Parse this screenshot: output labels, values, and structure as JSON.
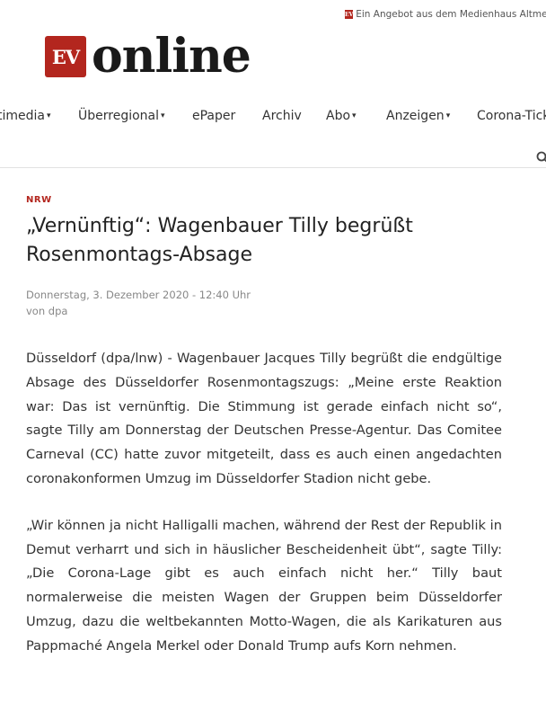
{
  "topbar": {
    "text": "Ein Angebot aus dem Medienhaus Altmep",
    "mini_logo": "EV"
  },
  "logo": {
    "box": "EV",
    "text": "online"
  },
  "nav": {
    "items": [
      {
        "label": "timedia",
        "caret": "▾"
      },
      {
        "label": "Überregional",
        "caret": "▾"
      },
      {
        "label": "ePaper",
        "caret": ""
      },
      {
        "label": "Archiv",
        "caret": ""
      },
      {
        "label": "Abo",
        "caret": "▾"
      },
      {
        "label": "Anzeigen",
        "caret": "▾"
      },
      {
        "label": "Corona-Tick",
        "caret": ""
      }
    ]
  },
  "article": {
    "category": "NRW",
    "title": "„Vernünftig“: Wagenbauer Tilly begrüßt Rosenmontags-Absage",
    "date": "Donnerstag, 3. Dezember 2020 - 12:40 Uhr",
    "author": "von dpa",
    "paragraphs": [
      "Düsseldorf (dpa/lnw) - Wagenbauer Jacques Tilly begrüßt die endgültige Absage des Düsseldorfer Rosenmontagszugs: „Meine erste Reaktion war: Das ist vernünftig. Die Stimmung ist gerade einfach nicht so“, sagte Tilly am Donnerstag der Deutschen Presse-Agentur. Das Comitee Carneval (CC) hatte zuvor mitgeteilt, dass es auch einen angedachten coronakonformen Umzug im Düsseldorfer Stadion nicht gebe.",
      "„Wir können ja nicht Halligalli machen, während der Rest der Republik in Demut verharrt und sich in häuslicher Bescheidenheit übt“, sagte Tilly: „Die Corona-Lage gibt es auch einfach nicht her.“ Tilly baut normalerweise die meisten Wagen der Gruppen beim Düsseldorfer Umzug, dazu die weltbekannten Motto-Wagen, die als Karikaturen aus Pappmaché Angela Merkel oder Donald Trump aufs Korn nehmen."
    ]
  },
  "colors": {
    "brand": "#b3261e",
    "text": "#333333",
    "meta": "#888888"
  }
}
